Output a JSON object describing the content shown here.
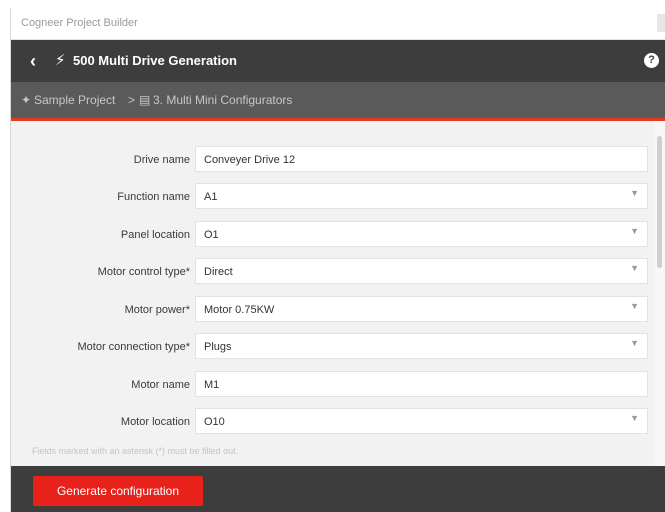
{
  "window": {
    "title": "Cogneer Project Builder"
  },
  "header": {
    "title": "500 Multi Drive Generation",
    "back_icon": "chevron-left-icon",
    "bolt_icon": "lightning-icon",
    "help_icon": "question-icon",
    "help_glyph": "?"
  },
  "breadcrumb": {
    "project_icon": "project-icon",
    "project": "Sample Project",
    "separator": ">",
    "configurator_icon": "form-icon",
    "configurator": "3. Multi Mini Configurators"
  },
  "form": {
    "fields": [
      {
        "label": "Drive name",
        "value": "Conveyer Drive 12",
        "type": "text"
      },
      {
        "label": "Function name",
        "value": "A1",
        "type": "select"
      },
      {
        "label": "Panel location",
        "value": "O1",
        "type": "select"
      },
      {
        "label": "Motor control type*",
        "value": "Direct",
        "type": "select"
      },
      {
        "label": "Motor power*",
        "value": "Motor 0.75KW",
        "type": "select"
      },
      {
        "label": "Motor connection type*",
        "value": "Plugs",
        "type": "select"
      },
      {
        "label": "Motor name",
        "value": "M1",
        "type": "text"
      },
      {
        "label": "Motor location",
        "value": "O10",
        "type": "select"
      }
    ],
    "note": "Fields marked with an asterisk (*) must be filled out."
  },
  "footer": {
    "generate_label": "Generate configuration"
  },
  "colors": {
    "accent": "#e8211b",
    "header_bg": "#3d3d3d",
    "breadcrumb_bg": "#5a5a5a",
    "accent_line": "#e23b1f"
  }
}
